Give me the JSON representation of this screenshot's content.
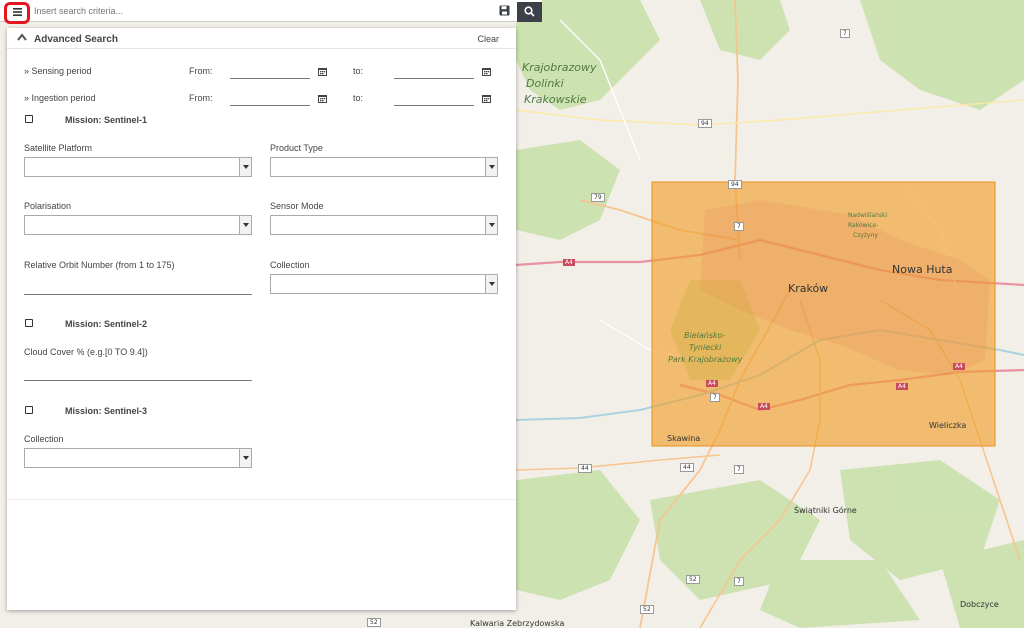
{
  "search": {
    "placeholder": "Insert search criteria..."
  },
  "toolbar": {
    "menu_icon": "hamburger-icon",
    "save_icon": "floppy-disk-icon",
    "search_icon": "magnifier-icon"
  },
  "panel": {
    "title": "Advanced Search",
    "clear_label": "Clear",
    "sensing": {
      "label": "» Sensing period",
      "from_label": "From:",
      "to_label": "to:"
    },
    "ingestion": {
      "label": "» Ingestion period",
      "from_label": "From:",
      "to_label": "to:"
    },
    "s1": {
      "mission_label": "Mission: Sentinel-1",
      "satellite_platform": "Satellite Platform",
      "product_type": "Product Type",
      "polarisation": "Polarisation",
      "sensor_mode": "Sensor Mode",
      "relative_orbit": "Relative Orbit Number (from 1 to 175)",
      "collection": "Collection"
    },
    "s2": {
      "mission_label": "Mission: Sentinel-2",
      "cloud_cover": "Cloud Cover % (e.g.[0 TO 9.4])"
    },
    "s3": {
      "mission_label": "Mission: Sentinel-3",
      "collection": "Collection"
    }
  },
  "map": {
    "labels": {
      "krajobrazowy": "Krajobrazowy",
      "dolinki": "Dolinki",
      "krakowskie": "Krakowskie",
      "krakow": "Kraków",
      "nowa_huta": "Nowa Huta",
      "bielansko1": "Bielańsko-",
      "bielansko2": "Tyniecki",
      "bielansko3": "Park Krajobrazowy",
      "nadwislanski1": "Nadwiślański",
      "nadwislanski2": "Rakowice-",
      "nadwislanski3": "Czyżyny",
      "skawina": "Skawina",
      "wieliczka": "Wieliczka",
      "swiatniki": "Świątniki Górne",
      "dobczyce": "Dobczyce",
      "kalwaria": "Kalwaria Zebrzydowska"
    },
    "roads": {
      "r94a": "94",
      "r94b": "94",
      "r79": "79",
      "r7a": "7",
      "r7b": "7",
      "r7c": "7",
      "r7d": "7",
      "r7e": "7",
      "a4a": "A4",
      "a4b": "A4",
      "a4c": "A4",
      "a4d": "A4",
      "a4e": "A4",
      "r44a": "44",
      "r44b": "44",
      "r52a": "52",
      "r52b": "52",
      "r52c": "52"
    },
    "colors": {
      "land": "#f2efe9",
      "forest": "#c8dfa8",
      "highlight": "#f0a030"
    }
  }
}
